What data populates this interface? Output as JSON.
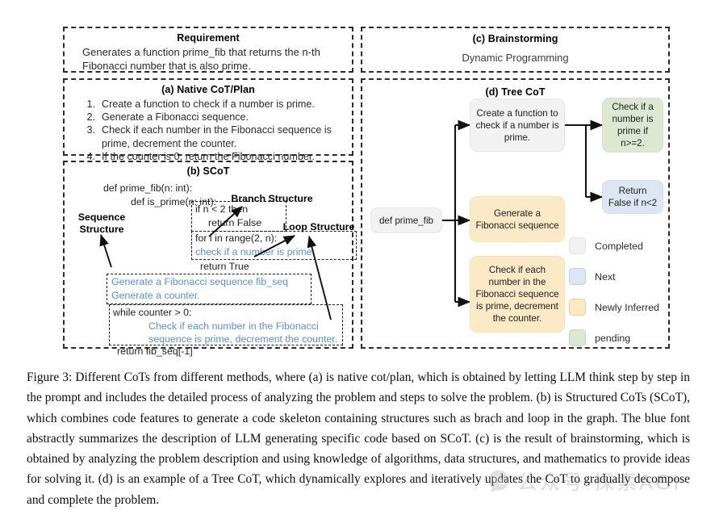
{
  "figure": {
    "number": "Figure 3",
    "caption": "Figure 3: Different CoTs from different methods, where (a) is native cot/plan, which is obtained by letting LLM think step by step in the prompt and includes the detailed process of analyzing the problem and steps to solve the problem. (b) is Structured CoTs (SCoT), which combines code features to generate a code skeleton containing structures such as brach and loop in the graph. The blue font abstractly summarizes the description of LLM generating specific code based on SCoT. (c) is the result of brainstorming, which is obtained by analyzing the problem description and using knowledge of algorithms, data structures, and mathematics to provide ideas for solving it. (d) is an example of a Tree CoT, which dynamically explores and iteratively updates the CoT to gradually decompose and complete the problem."
  },
  "requirement": {
    "title": "Requirement",
    "line1": "Generates a function prime_fib that returns the n-th",
    "line2": "Fibonacci number that is also prime."
  },
  "native_cot": {
    "title": "(a) Native CoT/Plan",
    "steps": [
      {
        "num": "1.",
        "text": "Create a function to check if a number is prime."
      },
      {
        "num": "2.",
        "text": "Generate a Fibonacci sequence."
      },
      {
        "num": "3.",
        "text": "Check if each number in the Fibonacci sequence is prime, decrement the counter."
      },
      {
        "num": "4.",
        "text": "If the counter is 0, return the Fibonacci number."
      }
    ]
  },
  "scot": {
    "title": "(b) SCoT",
    "code": {
      "def_prime_fib": "def prime_fib(n: int):",
      "def_is_prime": "def is_prime(n: int):",
      "if_line": "if n < 2 then",
      "return_false": "return False",
      "for_line": "for i in range(2, n):",
      "check_prime_blue": "check if a number is prime.",
      "return_true": "return True",
      "gen_fib_blue": "Generate a Fibonacci sequence fib_seq",
      "gen_counter_blue": "Generate a counter.",
      "while_line": "while counter > 0:",
      "check_each_blue_1": "Check if each number in the Fibonacci",
      "check_each_blue_2": "sequence is prime, decrement the counter.",
      "return_fib_seq": "return fib_seq[-1]"
    },
    "annotations": {
      "sequence_structure_1": "Sequence",
      "sequence_structure_2": "Structure",
      "branch_structure": "Branch Structure",
      "loop_structure": "Loop Structure"
    }
  },
  "brainstorming": {
    "title": "(c) Brainstorming",
    "idea": "Dynamic Programming"
  },
  "tree_cot": {
    "title": "(d) Tree CoT",
    "nodes": [
      {
        "id": "root",
        "label": "def prime_fib",
        "state": "completed"
      },
      {
        "id": "create-fn",
        "label": "Create a function to check if a number is prime.",
        "state": "completed"
      },
      {
        "id": "gen-fib",
        "label": "Generate a Fibonacci sequence",
        "state": "inferred"
      },
      {
        "id": "check-each",
        "label": "Check if each number in the Fibonacci sequence is prime, decrement the counter.",
        "state": "inferred"
      },
      {
        "id": "check-prime",
        "label": "Check if a number is prime if n>=2.",
        "state": "pending"
      },
      {
        "id": "return-false",
        "label": "Return False if n<2",
        "state": "next"
      }
    ],
    "legend": [
      {
        "label": "Completed",
        "color": "#f2f2f2",
        "border": "#e3e3e3"
      },
      {
        "label": "Next",
        "color": "#dce7f3",
        "border": "#b9cfe6"
      },
      {
        "label": "Newly Inferred",
        "color": "#fce9c6",
        "border": "#f5d089"
      },
      {
        "label": "pending",
        "color": "#dde8d2",
        "border": "#c3d9b3"
      }
    ]
  },
  "watermark": {
    "icon": "chat-bubble-icon",
    "text": "公众号 探索AGI"
  },
  "colors": {
    "blue_text": "#5b8fd4",
    "dashed_border": "#2b2b2b",
    "arrow": "#111111"
  }
}
